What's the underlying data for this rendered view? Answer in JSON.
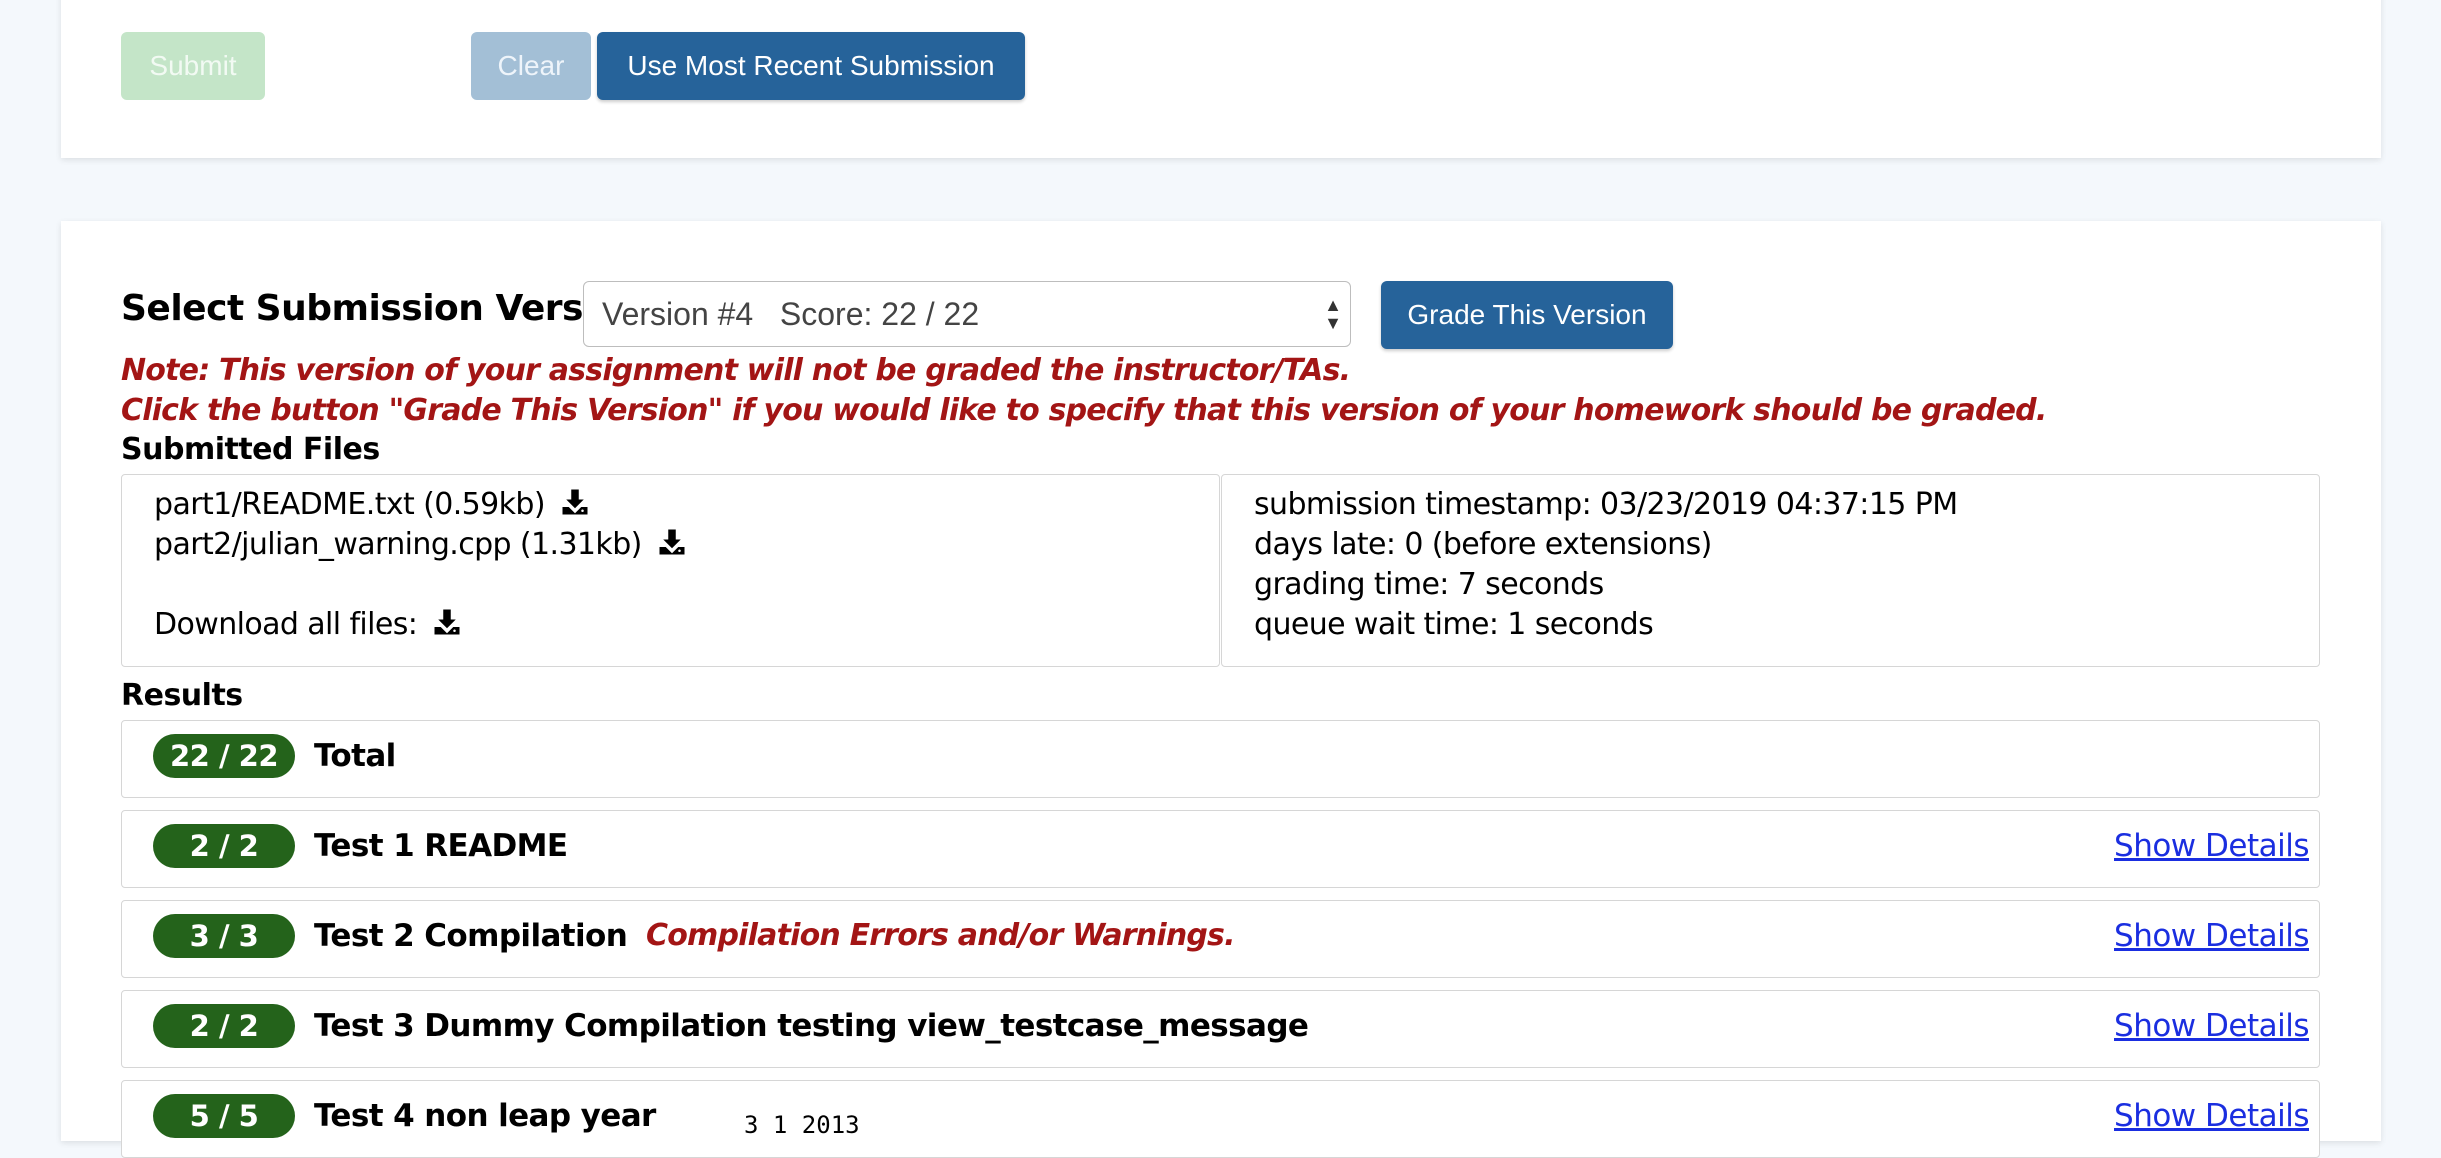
{
  "buttons": {
    "submit": "Submit",
    "clear": "Clear",
    "use_recent": "Use Most Recent Submission",
    "grade_version": "Grade This Version"
  },
  "version": {
    "label": "Select Submission Version:",
    "selected": "Version #4   Score: 22 / 22"
  },
  "notes": [
    "Note: This version of your assignment will not be graded the instructor/TAs.",
    "Click the button \"Grade This Version\" if you would like to specify that this version of your homework should be graded."
  ],
  "submitted_files": {
    "title": "Submitted Files",
    "files": [
      "part1/README.txt (0.59kb)",
      "part2/julian_warning.cpp (1.31kb)"
    ],
    "download_all": "Download all files:"
  },
  "submission_info": [
    "submission timestamp: 03/23/2019 04:37:15 PM",
    "days late: 0 (before extensions)",
    "grading time: 7 seconds",
    "queue wait time: 1 seconds"
  ],
  "results": {
    "title": "Results",
    "total": {
      "score": "22 / 22",
      "label": "Total"
    },
    "tests": [
      {
        "score": "2 / 2",
        "name": "Test 1 README",
        "details": "Show Details"
      },
      {
        "score": "3 / 3",
        "name": "Test 2 Compilation",
        "warning": "Compilation Errors and/or Warnings.",
        "details": "Show Details"
      },
      {
        "score": "2 / 2",
        "name": "Test 3 Dummy Compilation testing view_testcase_message",
        "details": "Show Details"
      },
      {
        "score": "5 / 5",
        "name": "Test 4 non leap year",
        "args": "3 1 2013",
        "details": "Show Details"
      }
    ]
  },
  "colors": {
    "primary": "#26639a",
    "badge_green": "#24631b",
    "warning_red": "#a31515",
    "link_blue": "#1a2ee0"
  },
  "icons": [
    "download-icon",
    "select-arrows-icon"
  ]
}
